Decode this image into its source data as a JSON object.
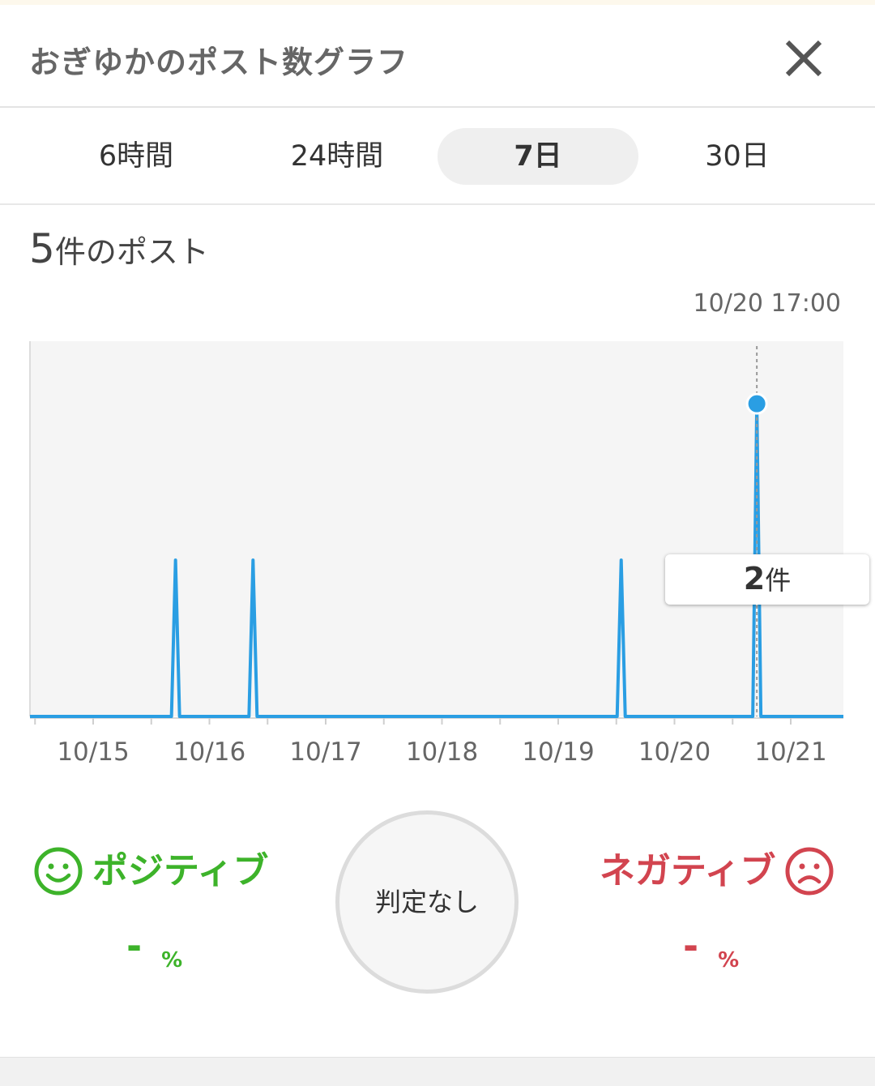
{
  "header": {
    "title": "おぎゆかのポスト数グラフ"
  },
  "tabs": [
    {
      "label": "6時間",
      "active": false
    },
    {
      "label": "24時間",
      "active": false
    },
    {
      "label": "7日",
      "active": true
    },
    {
      "label": "30日",
      "active": false
    }
  ],
  "summary": {
    "count": "5",
    "unit": "件のポスト"
  },
  "selection": {
    "time": "10/20 17:00",
    "count": "2",
    "unit": "件"
  },
  "chart_data": {
    "type": "line",
    "xlabel": "",
    "ylabel": "",
    "x_ticks": [
      "10/15",
      "10/16",
      "10/17",
      "10/18",
      "10/19",
      "10/20",
      "10/21"
    ],
    "x_range": [
      "10/14 12:00",
      "10/21 12:00"
    ],
    "ylim": [
      0,
      2.4
    ],
    "series": [
      {
        "color": "#2a9ee3",
        "points": [
          {
            "x": "10/15 17:00",
            "y": 1
          },
          {
            "x": "10/16 09:00",
            "y": 1
          },
          {
            "x": "10/19 13:00",
            "y": 1
          },
          {
            "x": "10/20 17:00",
            "y": 2
          }
        ]
      }
    ],
    "selected_x": "10/20 17:00",
    "grid": false,
    "background": "#f5f5f5"
  },
  "sentiment": {
    "positive": {
      "label": "ポジティブ",
      "value": "-",
      "unit": "%",
      "color": "#3db32a",
      "icon": "smile-face-icon"
    },
    "neutral": {
      "label": "判定なし"
    },
    "negative": {
      "label": "ネガティブ",
      "value": "-",
      "unit": "%",
      "color": "#d2444f",
      "icon": "sad-face-icon"
    }
  }
}
